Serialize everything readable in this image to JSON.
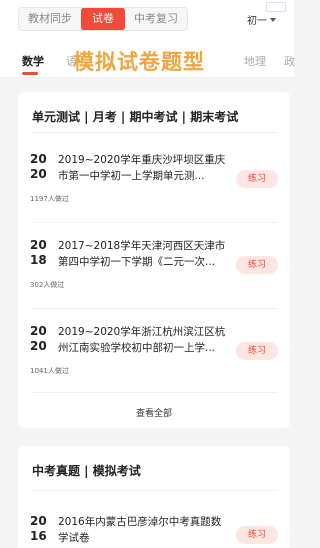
{
  "top_tabs": {
    "items": [
      {
        "label": "教材同步"
      },
      {
        "label": "试卷"
      },
      {
        "label": "中考复习"
      }
    ],
    "grade": "初一"
  },
  "overlay_title": "模拟试卷题型",
  "subjects": {
    "items": [
      "数学",
      "语",
      "地理",
      "政"
    ]
  },
  "section1": {
    "heading": "单元测试 | 月考 | 期中考试 | 期末考试",
    "items": [
      {
        "year_top": "20",
        "year_bottom": "20",
        "title": "2019~2020学年重庆沙坪坝区重庆市第一中学初一上学期单元测...",
        "meta": "1197人做过",
        "action": "练习"
      },
      {
        "year_top": "20",
        "year_bottom": "18",
        "title": "2017~2018学年天津河西区天津市第四中学初一下学期《二元一次...",
        "meta": "302人做过",
        "action": "练习"
      },
      {
        "year_top": "20",
        "year_bottom": "20",
        "title": "2019~2020学年浙江杭州滨江区杭州江南实验学校初中部初一上学...",
        "meta": "1041人做过",
        "action": "练习"
      }
    ],
    "view_all": "查看全部"
  },
  "section2": {
    "heading": "中考真题 | 模拟考试",
    "items": [
      {
        "year_top": "20",
        "year_bottom": "16",
        "title": "2016年内蒙古巴彦淖尔中考真题数学试卷",
        "action": "练习"
      }
    ]
  }
}
